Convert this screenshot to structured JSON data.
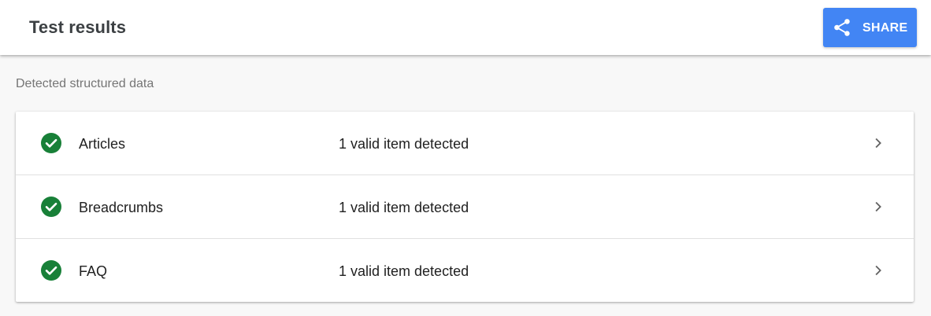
{
  "header": {
    "title": "Test results",
    "share_label": "SHARE",
    "share_icon": "share-icon"
  },
  "section": {
    "label": "Detected structured data"
  },
  "items": [
    {
      "name": "Articles",
      "status": "1 valid item detected",
      "icon": "check-circle-icon"
    },
    {
      "name": "Breadcrumbs",
      "status": "1 valid item detected",
      "icon": "check-circle-icon"
    },
    {
      "name": "FAQ",
      "status": "1 valid item detected",
      "icon": "check-circle-icon"
    }
  ],
  "colors": {
    "accent": "#4285f4",
    "valid": "#188038",
    "text": "#212121",
    "muted": "#757575"
  }
}
